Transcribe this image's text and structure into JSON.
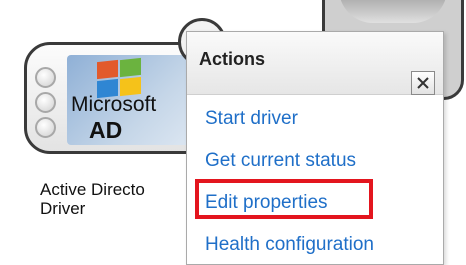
{
  "driver": {
    "logo_line1": "Microsoft",
    "logo_line2": "AD",
    "caption": "Active Directo\nDriver",
    "caption_line1": "Active Directo",
    "caption_line2": "Driver"
  },
  "menu": {
    "title": "Actions",
    "close_icon": "close-x-icon",
    "items": [
      {
        "label": "Start driver"
      },
      {
        "label": "Get current status"
      },
      {
        "label": "Edit properties",
        "highlighted": true
      },
      {
        "label": "Health configuration"
      }
    ]
  },
  "colors": {
    "link": "#1f6fc8",
    "highlight_border": "#e3151e"
  }
}
